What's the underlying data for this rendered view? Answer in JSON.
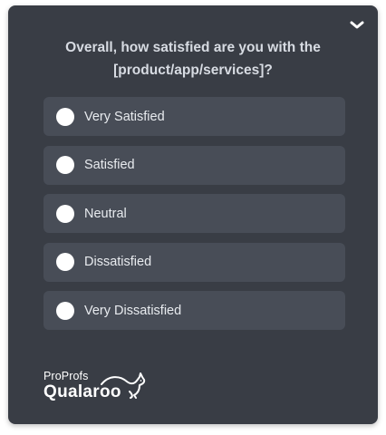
{
  "survey": {
    "question": "Overall, how satisfied are you with the [product/app/services]?",
    "options": [
      {
        "label": "Very Satisfied"
      },
      {
        "label": "Satisfied"
      },
      {
        "label": "Neutral"
      },
      {
        "label": "Dissatisfied"
      },
      {
        "label": "Very Dissatisfied"
      }
    ],
    "collapse_icon": "chevron-down-icon"
  },
  "branding": {
    "line1": "ProProfs",
    "line2": "Qualaroo",
    "mark_icon": "kangaroo-icon"
  },
  "colors": {
    "panel": "#393d45",
    "option_bg": "#484d57",
    "text": "#e8ebef"
  }
}
